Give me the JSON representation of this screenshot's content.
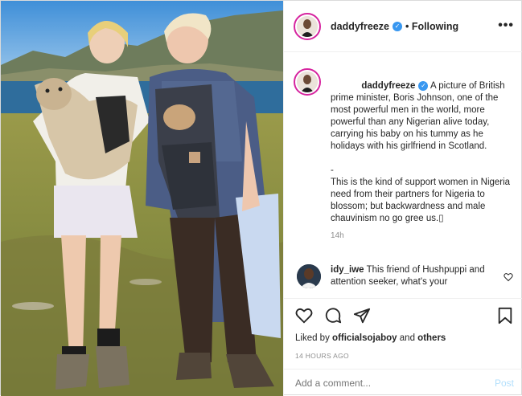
{
  "post": {
    "username": "daddyfreeze",
    "follow_status": "Following",
    "more_label": "•••",
    "caption_p1": "A picture of British prime minister, Boris Johnson, one of the most powerful men in the world, more powerful than any Nigerian alive today, carrying his baby on his tummy as he holidays with his girlfriend in Scotland.",
    "caption_sep": "-",
    "caption_p2": "This is the kind of support women in Nigeria need from their partners for Nigeria to blossom; but backwardness and male chauvinism no go gree us.▯",
    "caption_age": "14h"
  },
  "comment": {
    "username": "idy_iwe",
    "text": "This friend of Hushpuppi and attention seeker, what's your"
  },
  "likes": {
    "prefix": "Liked by",
    "first": "officialsojaboy",
    "and": "and",
    "others": "others"
  },
  "timestamp": "14 HOURS AGO",
  "add_comment": {
    "placeholder": "Add a comment...",
    "post_label": "Post"
  },
  "icons": {
    "like": "heart-icon",
    "comment": "comment-icon",
    "share": "share-icon",
    "save": "bookmark-icon",
    "verified": "verified-badge-icon",
    "comment_like": "small-heart-icon"
  },
  "colors": {
    "verified": "#3897f0",
    "post_button": "#b2dffc",
    "muted": "#8e8e8e"
  }
}
